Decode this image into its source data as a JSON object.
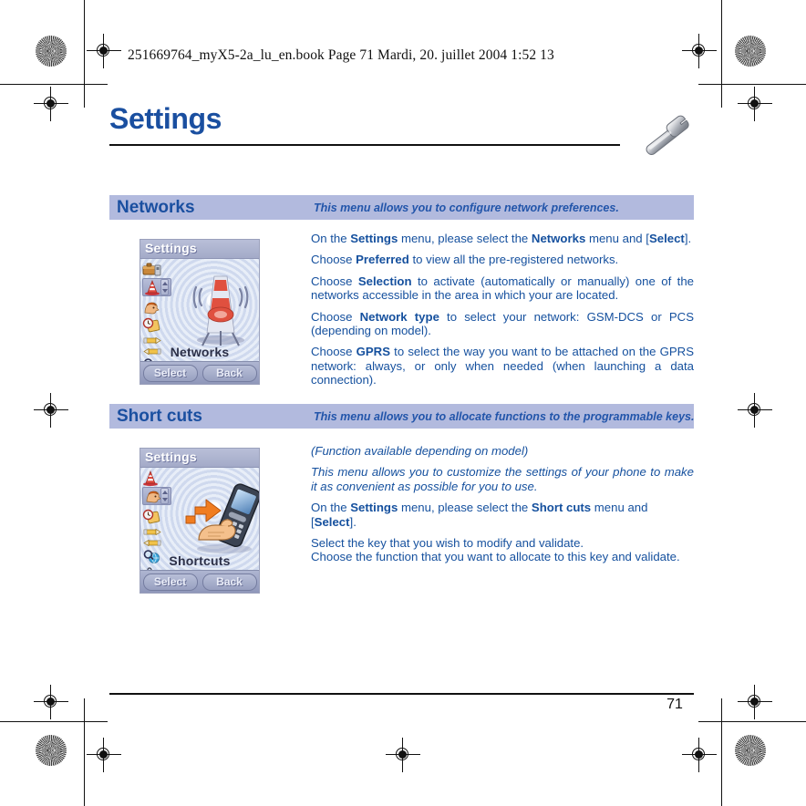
{
  "print_header": {
    "book_line": "251669764_myX5-2a_lu_en.book  Page 71  Mardi, 20. juillet 2004  1:52 13"
  },
  "chapter": {
    "title": "Settings",
    "icon": "wrench-icon"
  },
  "sections": [
    {
      "id": "networks",
      "title": "Networks",
      "description": "This menu allows you to configure network preferences.",
      "screenshot": {
        "title": "Settings",
        "label": "Networks",
        "softkey_left": "Select",
        "softkey_right": "Back",
        "graphic": "radio-tower-icon"
      },
      "paragraphs": [
        "On the <b>Settings</b> menu, please select the <b>Networks</b> menu and [<b>Select</b>].",
        "Choose <b>Preferred</b> to view all the pre-registered networks.",
        "Choose <b>Selection</b> to activate (automatically or manually) one of the networks accessible in the area in which your are located.",
        "Choose <b>Network type</b> to select your network: GSM-DCS or PCS (depending on model).",
        "Choose <b>GPRS</b> to select the way you want to be attached on the GPRS network: always, or only when needed (when launching a data connection)."
      ]
    },
    {
      "id": "short-cuts",
      "title": "Short cuts",
      "description": "This menu allows you to allocate functions to the programmable keys.",
      "screenshot": {
        "title": "Settings",
        "label": "Shortcuts",
        "softkey_left": "Select",
        "softkey_right": "Back",
        "graphic": "hand-pointing-phone-icon"
      },
      "paragraphs": [
        "<i>(Function available depending on model)</i>",
        "<i>This menu allows you to customize the settings of your phone to make it as convenient as possible for you to use.</i>",
        "On the <b>Settings</b> menu, please select the <b>Short cuts</b> menu and [<b>Select</b>].",
        "Select the key that you wish to modify and validate.<br>Choose the function that you want to allocate to this key and validate."
      ]
    }
  ],
  "footer": {
    "page_number": "71"
  },
  "colors": {
    "heading_blue": "#1a4fa0",
    "body_blue": "#15509e",
    "band_background": "#b2bade",
    "band_description": "#2255aa"
  }
}
